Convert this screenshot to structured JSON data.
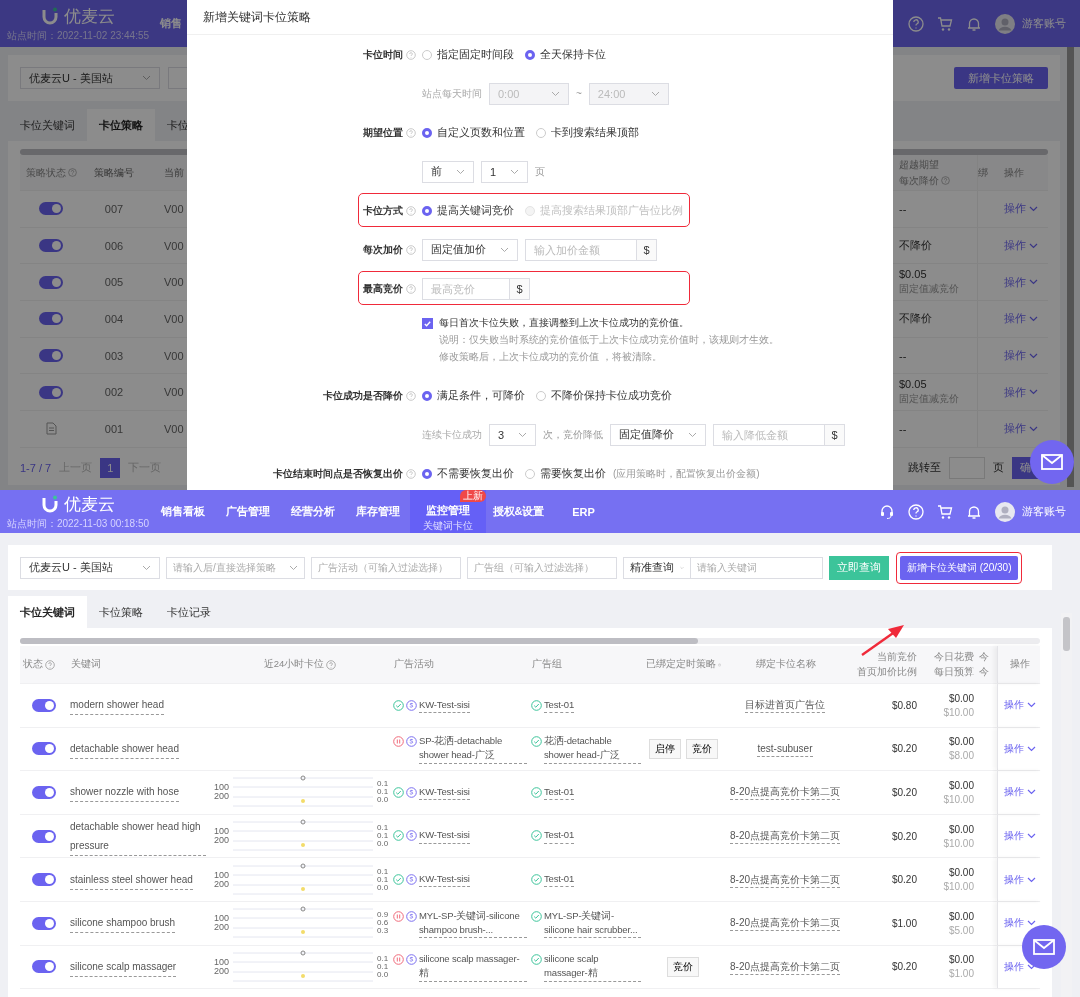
{
  "top": {
    "background": {
      "header": {
        "logo": "优麦云",
        "site_time": "站点时间：2022-11-02 23:44:55",
        "nav_partial": "销售",
        "account": "游客账号"
      },
      "store_select": "优麦云U - 美国站",
      "tabs": [
        {
          "label": "卡位关键词",
          "selected": false
        },
        {
          "label": "卡位策略",
          "selected": true
        },
        {
          "label": "卡位",
          "selected": false
        }
      ],
      "add_button": "新增卡位策略",
      "columns": {
        "status": "策略状态",
        "id": "策略编号",
        "version": "当前",
        "reduce": [
          "超越期望",
          "每次降价"
        ],
        "bind": "绑",
        "action": "操作"
      },
      "rows": [
        {
          "kind": "toggle",
          "on": true,
          "id": "007",
          "version": "V00",
          "reduce": "--",
          "action": "操作"
        },
        {
          "kind": "toggle",
          "on": true,
          "id": "006",
          "version": "V00",
          "reduce": "不降价",
          "action": "操作"
        },
        {
          "kind": "toggle",
          "on": true,
          "id": "005",
          "version": "V00",
          "reduce": "$0.05",
          "reduce_note": "固定值减竞价",
          "action": "操作"
        },
        {
          "kind": "toggle",
          "on": true,
          "id": "004",
          "version": "V00",
          "reduce": "不降价",
          "action": "操作"
        },
        {
          "kind": "toggle",
          "on": true,
          "id": "003",
          "version": "V00",
          "reduce": "--",
          "action": "操作"
        },
        {
          "kind": "toggle",
          "on": true,
          "id": "002",
          "version": "V00",
          "reduce": "$0.05",
          "reduce_note": "固定值减竞价",
          "action": "操作"
        },
        {
          "kind": "file",
          "id": "001",
          "version": "V00",
          "reduce": "--",
          "action": "操作"
        }
      ],
      "pagination": {
        "range": "1-7 / 7",
        "prev": "上一页",
        "pages": [
          {
            "label": "1",
            "selected": true
          }
        ],
        "next": "下一页",
        "jump": "跳转至",
        "unit": "页",
        "confirm": "确"
      }
    },
    "drawer": {
      "title": "新增关键词卡位策略",
      "form": [
        {
          "kind": "field",
          "label": "卡位时间",
          "help": true,
          "highlight": false,
          "controls": [
            {
              "kind": "radio",
              "label": "指定固定时间段",
              "selected": false,
              "disabled": false
            },
            {
              "kind": "radio",
              "label": "全天保持卡位",
              "selected": true,
              "disabled": false
            }
          ]
        },
        {
          "kind": "sub",
          "label": "站点每天时间",
          "controls": [
            {
              "kind": "select",
              "value": "0:00",
              "disabled": true
            },
            {
              "kind": "text",
              "text": "~"
            },
            {
              "kind": "select",
              "value": "24:00",
              "disabled": true
            }
          ]
        },
        {
          "kind": "field",
          "label": "期望位置",
          "help": true,
          "highlight": false,
          "controls": [
            {
              "kind": "radio",
              "label": "自定义页数和位置",
              "selected": true,
              "disabled": false
            },
            {
              "kind": "radio",
              "label": "卡到搜索结果顶部",
              "selected": false,
              "disabled": false
            }
          ]
        },
        {
          "kind": "sub",
          "controls": [
            {
              "kind": "select",
              "value": "前",
              "disabled": false
            },
            {
              "kind": "select",
              "value": "1",
              "disabled": false
            },
            {
              "kind": "text",
              "text": "页"
            }
          ]
        },
        {
          "kind": "field",
          "label": "卡位方式",
          "help": true,
          "highlight": true,
          "controls": [
            {
              "kind": "radio",
              "label": "提高关键词竞价",
              "selected": true,
              "disabled": false
            },
            {
              "kind": "radio",
              "label": "提高搜索结果顶部广告位比例",
              "selected": false,
              "disabled": true
            }
          ]
        },
        {
          "kind": "field",
          "label": "每次加价",
          "help": true,
          "highlight": false,
          "controls": [
            {
              "kind": "select",
              "value": "固定值加价",
              "disabled": false
            },
            {
              "kind": "input",
              "placeholder": "输入加价金额",
              "addon": "$"
            }
          ]
        },
        {
          "kind": "field",
          "label": "最高竞价",
          "help": true,
          "highlight": true,
          "controls": [
            {
              "kind": "input",
              "placeholder": "最高竞价",
              "addon": "$"
            }
          ]
        },
        {
          "kind": "check",
          "checked": true,
          "text": "每日首次卡位失败，直接调整到上次卡位成功的竞价值。",
          "notes": [
            "说明：仅失败当时系统的竞价值低于上次卡位成功竞价值时，该规则才生效。",
            "修改策略后，上次卡位成功的竞价值 ，将被清除。"
          ]
        },
        {
          "kind": "field",
          "label": "卡位成功是否降价",
          "help": true,
          "highlight": false,
          "controls": [
            {
              "kind": "radio",
              "label": "满足条件，可降价",
              "selected": true,
              "disabled": false
            },
            {
              "kind": "radio",
              "label": "不降价保持卡位成功竞价",
              "selected": false,
              "disabled": false
            }
          ]
        },
        {
          "kind": "sub",
          "label": "连续卡位成功",
          "controls": [
            {
              "kind": "select",
              "value": "3",
              "disabled": false
            },
            {
              "kind": "text",
              "text": "次，竞价降低"
            },
            {
              "kind": "select",
              "value": "固定值降价",
              "disabled": false
            },
            {
              "kind": "input",
              "placeholder": "输入降低金额",
              "addon": "$"
            }
          ]
        },
        {
          "kind": "field",
          "label": "卡位结束时间点是否恢复出价",
          "help": true,
          "highlight": false,
          "controls": [
            {
              "kind": "radio",
              "label": "不需要恢复出价",
              "selected": true,
              "disabled": false
            },
            {
              "kind": "radio",
              "label": "需要恢复出价",
              "note": "(应用策略时，配置恢复出价金额)",
              "selected": false,
              "disabled": false
            }
          ]
        }
      ]
    }
  },
  "bottom": {
    "header": {
      "logo": "优麦云",
      "site_time": "站点时间：2022-11-03 00:18:50",
      "account": "游客账号",
      "nav": [
        {
          "label": "销售看板",
          "selected": false
        },
        {
          "label": "广告管理",
          "selected": false
        },
        {
          "label": "经营分析",
          "selected": false
        },
        {
          "label": "库存管理",
          "selected": false
        },
        {
          "label": "监控管理",
          "sub": "关键词卡位",
          "badge": "上新",
          "selected": true
        },
        {
          "label": "授权&设置",
          "selected": false
        },
        {
          "label": "ERP",
          "selected": false
        }
      ]
    },
    "filters": {
      "store": "优麦云U - 美国站",
      "strategy_placeholder": "请输入后/直接选择策略",
      "campaign_placeholder": "广告活动（可输入过滤选择）",
      "group_placeholder": "广告组（可输入过滤选择）",
      "match": "精准查询",
      "keyword_placeholder": "请输入关键词",
      "search_button": "立即查询",
      "add_button": "新增卡位关键词 (20/30)",
      "add_highlight": true
    },
    "tabs": [
      {
        "label": "卡位关键词",
        "selected": true
      },
      {
        "label": "卡位策略",
        "selected": false
      },
      {
        "label": "卡位记录",
        "selected": false
      }
    ],
    "columns": [
      {
        "lines": [
          "状态"
        ],
        "help": true
      },
      {
        "lines": [
          "关键词"
        ]
      },
      {
        "lines": [
          "近24小时卡位"
        ],
        "help": true
      },
      {
        "lines": [
          "广告活动"
        ]
      },
      {
        "lines": [
          "广告组"
        ]
      },
      {
        "lines": [
          "已绑定定时策略"
        ],
        "help": true
      },
      {
        "lines": [
          "绑定卡位名称"
        ]
      },
      {
        "lines": [
          "当前竞价",
          "首页加价比例"
        ]
      },
      {
        "lines": [
          "今日花费",
          "每日预算"
        ]
      },
      {
        "lines": [
          "今",
          "今"
        ]
      },
      {
        "lines": [
          "操作"
        ]
      }
    ],
    "rows": [
      {
        "on": true,
        "keyword": "modern shower head",
        "campaign": {
          "paused": false,
          "name": "KW-Test-sisi"
        },
        "ad_group": {
          "paused": false,
          "name": "Test-01"
        },
        "policies": [],
        "slot": "目标进首页广告位",
        "bid": "$0.80",
        "spend": "$0.00",
        "budget": "$10.00",
        "action": "操作"
      },
      {
        "on": true,
        "keyword": "detachable shower head",
        "campaign": {
          "paused": true,
          "name": "SP-花洒-detachable shower head-广泛"
        },
        "ad_group": {
          "paused": false,
          "name": "花洒-detachable shower head-广泛"
        },
        "policies": [
          "启停",
          "竞价"
        ],
        "slot": "test-subuser",
        "bid": "$0.20",
        "spend": "$0.00",
        "budget": "$8.00",
        "action": "操作"
      },
      {
        "on": true,
        "keyword": "shower nozzle with hose",
        "chart": {
          "left_ticks": [
            "100",
            "200"
          ],
          "right_ticks": [
            "0.1",
            "0.1",
            "0.0"
          ]
        },
        "campaign": {
          "paused": false,
          "name": "KW-Test-sisi"
        },
        "ad_group": {
          "paused": false,
          "name": "Test-01"
        },
        "policies": [],
        "slot": "8-20点提高竞价卡第二页",
        "bid": "$0.20",
        "spend": "$0.00",
        "budget": "$10.00",
        "action": "操作"
      },
      {
        "on": true,
        "keyword": "detachable shower head high pressure",
        "chart": {
          "left_ticks": [
            "100",
            "200"
          ],
          "right_ticks": [
            "0.1",
            "0.1",
            "0.0"
          ]
        },
        "campaign": {
          "paused": false,
          "name": "KW-Test-sisi"
        },
        "ad_group": {
          "paused": false,
          "name": "Test-01"
        },
        "policies": [],
        "slot": "8-20点提高竞价卡第二页",
        "bid": "$0.20",
        "spend": "$0.00",
        "budget": "$10.00",
        "action": "操作"
      },
      {
        "on": true,
        "keyword": "stainless steel shower head",
        "chart": {
          "left_ticks": [
            "100",
            "200"
          ],
          "right_ticks": [
            "0.1",
            "0.1",
            "0.0"
          ]
        },
        "campaign": {
          "paused": false,
          "name": "KW-Test-sisi"
        },
        "ad_group": {
          "paused": false,
          "name": "Test-01"
        },
        "policies": [],
        "slot": "8-20点提高竞价卡第二页",
        "bid": "$0.20",
        "spend": "$0.00",
        "budget": "$10.00",
        "action": "操作"
      },
      {
        "on": true,
        "keyword": "silicone shampoo brush",
        "chart": {
          "left_ticks": [
            "100",
            "200"
          ],
          "right_ticks": [
            "0.9",
            "0.6",
            "0.3"
          ]
        },
        "campaign": {
          "paused": true,
          "name": "MYL-SP-关键词-silicone shampoo brush-..."
        },
        "ad_group": {
          "paused": false,
          "name": "MYL-SP-关键词-silicone hair scrubber..."
        },
        "policies": [],
        "slot": "8-20点提高竞价卡第二页",
        "bid": "$1.00",
        "spend": "$0.00",
        "budget": "$5.00",
        "action": "操作"
      },
      {
        "on": true,
        "keyword": "silicone scalp massager",
        "chart": {
          "left_ticks": [
            "100",
            "200"
          ],
          "right_ticks": [
            "0.1",
            "0.1",
            "0.0"
          ]
        },
        "campaign": {
          "paused": true,
          "name": "silicone scalp massager-精"
        },
        "ad_group": {
          "paused": false,
          "name": "silicone scalp massager-精"
        },
        "policies": [
          "竞价"
        ],
        "slot": "8-20点提高竞价卡第二页",
        "bid": "$0.20",
        "spend": "$0.00",
        "budget": "$1.00",
        "action": "操作"
      }
    ]
  }
}
